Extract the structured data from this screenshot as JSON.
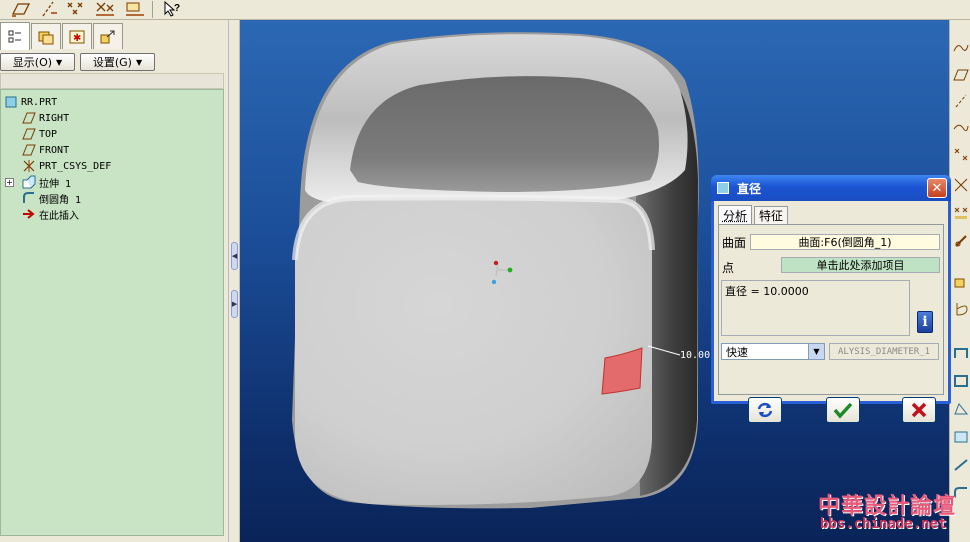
{
  "toolbar": {
    "icons": [
      "datum-plane-icon",
      "datum-axis-icon",
      "datum-point-icon",
      "datum-csys-icon",
      "datum-show-icon",
      "context-help-icon"
    ]
  },
  "left_panel": {
    "tabs": [
      {
        "name": "model-tree-icon",
        "active": true
      },
      {
        "name": "folder-browser-icon",
        "active": false
      },
      {
        "name": "favorites-icon",
        "active": false
      },
      {
        "name": "connections-icon",
        "active": false
      }
    ],
    "show_button": "显示(O)",
    "settings_button": "设置(G)",
    "tree": [
      {
        "label": "RR.PRT",
        "icon": "part-icon",
        "indent": 0
      },
      {
        "label": "RIGHT",
        "icon": "datum-plane-icon",
        "indent": 1
      },
      {
        "label": "TOP",
        "icon": "datum-plane-icon",
        "indent": 1
      },
      {
        "label": "FRONT",
        "icon": "datum-plane-icon",
        "indent": 1
      },
      {
        "label": "PRT_CSYS_DEF",
        "icon": "csys-icon",
        "indent": 1
      },
      {
        "label": "拉伸 1",
        "icon": "extrude-icon",
        "indent": 1,
        "expandable": true
      },
      {
        "label": "倒圆角 1",
        "icon": "round-icon",
        "indent": 1
      },
      {
        "label": "在此插入",
        "icon": "insert-here-icon",
        "indent": 1
      }
    ]
  },
  "viewport": {
    "dimension_text": "10.00",
    "colors": {
      "surface_highlight": "#e46b6b",
      "background_top": "#2b68b4",
      "background_bottom": "#0a2458"
    }
  },
  "dialog": {
    "title": "直径",
    "tabs": [
      {
        "label": "分析",
        "active": true
      },
      {
        "label": "特征",
        "active": false
      }
    ],
    "surface_label": "曲面",
    "surface_value": "曲面:F6(倒圆角_1)",
    "point_label": "点",
    "point_value": "单击此处添加项目",
    "result_text": "直径 = 10.0000",
    "mode_select": "快速",
    "analysis_name": "ALYSIS_DIAMETER_1",
    "buttons": [
      "repeat-icon",
      "ok-check-icon",
      "cancel-x-icon"
    ]
  },
  "watermark": {
    "title": "中華設計論壇",
    "url": "bbs.chinade.net"
  }
}
